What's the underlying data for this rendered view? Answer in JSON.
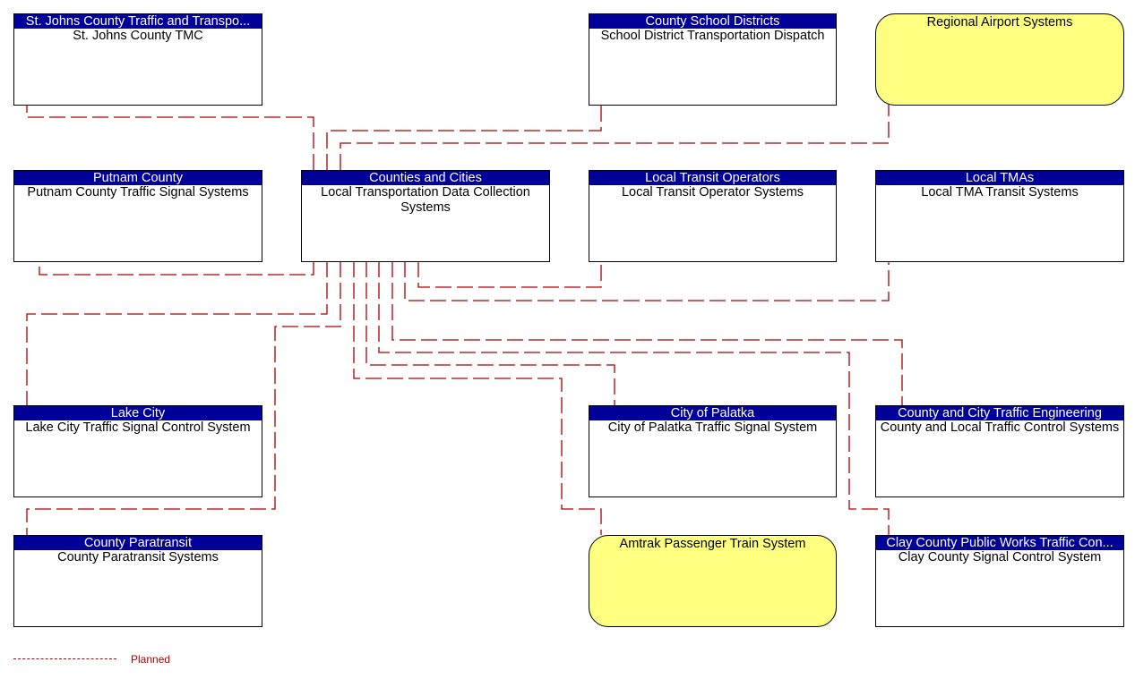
{
  "diagram": {
    "colors": {
      "header_bg": "#000099",
      "header_text": "#ffffff",
      "external_fill": "#ffff80",
      "planned_line": "#aa0000"
    },
    "nodes": [
      {
        "id": "st-johns",
        "header": "St. Johns County Traffic and Transpo...",
        "label": "St. Johns County TMC",
        "kind": "element"
      },
      {
        "id": "school",
        "header": "County School Districts",
        "label": "School District Transportation Dispatch",
        "kind": "element"
      },
      {
        "id": "airport",
        "header": "",
        "label": "Regional Airport Systems",
        "kind": "external"
      },
      {
        "id": "putnam",
        "header": "Putnam County",
        "label": "Putnam County Traffic Signal Systems",
        "kind": "element"
      },
      {
        "id": "center",
        "header": "Counties and Cities",
        "label": "Local Transportation Data Collection Systems",
        "kind": "element"
      },
      {
        "id": "transit",
        "header": "Local Transit Operators",
        "label": "Local Transit Operator Systems",
        "kind": "element"
      },
      {
        "id": "tma",
        "header": "Local TMAs",
        "label": "Local TMA Transit Systems",
        "kind": "element"
      },
      {
        "id": "lake-city",
        "header": "Lake City",
        "label": "Lake City Traffic Signal Control System",
        "kind": "element"
      },
      {
        "id": "palatka",
        "header": "City of Palatka",
        "label": "City of Palatka Traffic Signal System",
        "kind": "element"
      },
      {
        "id": "county-eng",
        "header": "County and City Traffic Engineering",
        "label": "County and Local Traffic Control Systems",
        "kind": "element"
      },
      {
        "id": "paratransit",
        "header": "County Paratransit",
        "label": "County Paratransit Systems",
        "kind": "element"
      },
      {
        "id": "amtrak",
        "header": "",
        "label": "Amtrak Passenger Train System",
        "kind": "external"
      },
      {
        "id": "clay",
        "header": "Clay County Public Works Traffic Con...",
        "label": "Clay County Signal Control System",
        "kind": "element"
      }
    ],
    "connections": [
      {
        "from": "center",
        "to": "st-johns",
        "status": "Planned"
      },
      {
        "from": "center",
        "to": "school",
        "status": "Planned"
      },
      {
        "from": "center",
        "to": "airport",
        "status": "Planned"
      },
      {
        "from": "center",
        "to": "putnam",
        "status": "Planned"
      },
      {
        "from": "center",
        "to": "lake-city",
        "status": "Planned"
      },
      {
        "from": "center",
        "to": "paratransit",
        "status": "Planned"
      },
      {
        "from": "center",
        "to": "amtrak",
        "status": "Planned"
      },
      {
        "from": "center",
        "to": "palatka",
        "status": "Planned"
      },
      {
        "from": "center",
        "to": "clay",
        "status": "Planned"
      },
      {
        "from": "center",
        "to": "county-eng",
        "status": "Planned"
      },
      {
        "from": "center",
        "to": "tma",
        "status": "Planned"
      },
      {
        "from": "center",
        "to": "transit",
        "status": "Planned"
      }
    ]
  },
  "legend": {
    "planned_label": "Planned"
  }
}
